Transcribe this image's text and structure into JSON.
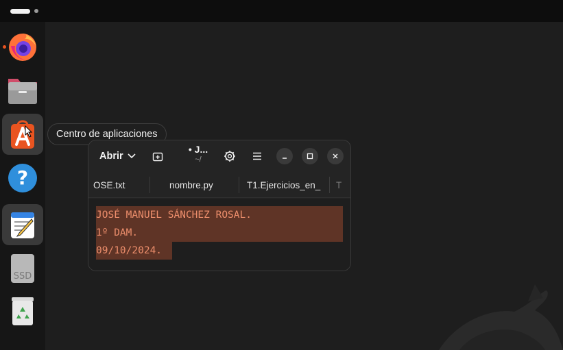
{
  "topbar": {
    "workspace_indicator": "active-workspace",
    "icons": [
      "workspace-pill",
      "workspace-dot"
    ]
  },
  "dock": {
    "items": [
      {
        "name": "Firefox",
        "icon": "firefox-icon",
        "running": true
      },
      {
        "name": "Archivos",
        "icon": "files-icon",
        "running": false
      },
      {
        "name": "Centro de aplicaciones",
        "icon": "app-center-icon",
        "running": false,
        "hovered": true
      },
      {
        "name": "Ayuda",
        "icon": "help-icon",
        "running": false
      },
      {
        "name": "Editor de texto",
        "icon": "text-editor-icon",
        "running": true,
        "active": true
      },
      {
        "name": "SSD",
        "icon": "ssd-drive-icon",
        "label": "SSD"
      },
      {
        "name": "Papelera",
        "icon": "trash-icon"
      }
    ],
    "tooltip": "Centro de aplicaciones"
  },
  "editor": {
    "open_label": "Abrir",
    "title": "• J...",
    "subtitle": "~/",
    "tabs": [
      {
        "label": "OSE.txt"
      },
      {
        "label": "nombre.py"
      },
      {
        "label": "T1.Ejercicios_en_"
      },
      {
        "label": "T"
      }
    ],
    "lines": [
      "JOSÉ MANUEL SÁNCHEZ ROSAL.",
      "1º DAM.",
      "09/10/2024."
    ]
  },
  "colors": {
    "accent": "#e95420",
    "selection": "#5f3426",
    "text": "#ed8e6c",
    "window_bg": "#242424",
    "desktop_bg": "#1e1e1e"
  }
}
